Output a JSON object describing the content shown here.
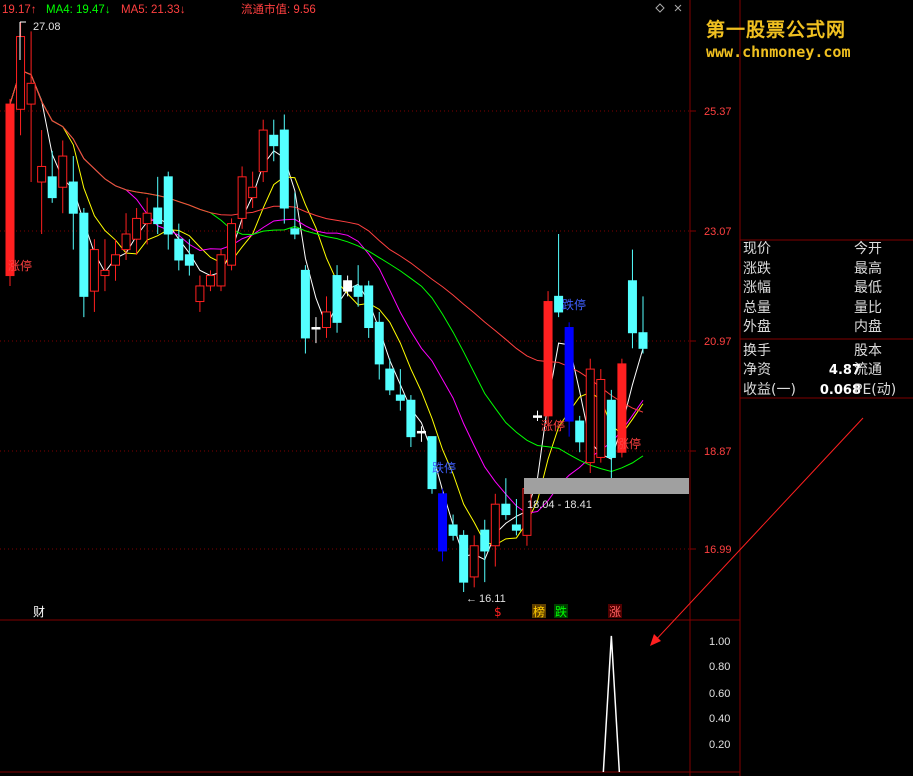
{
  "header": {
    "ma3": "19.17↑",
    "ma4": "MA4: 19.47↓",
    "ma5": "MA5: 21.33↓",
    "float_cap": "流通市值: 9.56"
  },
  "watermark": {
    "line1": "第一股票公式网",
    "line2": "www.chnmoney.com"
  },
  "quote_panel": {
    "rows": [
      {
        "left": "现价",
        "value": "",
        "right": "今开"
      },
      {
        "left": "涨跌",
        "value": "",
        "right": "最高"
      },
      {
        "left": "涨幅",
        "value": "",
        "right": "最低"
      },
      {
        "left": "总量",
        "value": "",
        "right": "量比"
      },
      {
        "left": "外盘",
        "value": "",
        "right": "内盘"
      },
      {
        "left": "换手",
        "value": "",
        "right": "股本"
      },
      {
        "left": "净资",
        "value": "4.87",
        "right": "流通"
      },
      {
        "left": "收益(一)",
        "value": "0.068",
        "right": "PE(动)"
      }
    ]
  },
  "colors": {
    "up": "#ff2020",
    "down": "#54ffff",
    "limit_down": "#0000ff",
    "grid": "#800000",
    "ma1": "#ffffff",
    "ma2": "#ffff00",
    "ma3": "#ff00ff",
    "ma4": "#00ff00",
    "ma5": "#ff4040"
  },
  "chart_data": [
    {
      "type": "candlestick",
      "y_ticks": [
        "25.37",
        "23.07",
        "20.97",
        "18.87",
        "16.99"
      ],
      "ylim": [
        14.5,
        29.0
      ],
      "grid": true,
      "price_high_label": "27.08",
      "price_low_label": "16.11",
      "range_box_label": "18.04 - 18.41",
      "range_box": [
        18.04,
        18.41
      ],
      "event_markers": [
        "财",
        "$",
        "榜",
        "跌",
        "涨"
      ],
      "annotations": [
        "涨停",
        "跌停",
        "涨停",
        "跌停",
        "涨停"
      ],
      "candles": [
        {
          "o": 22.2,
          "h": 25.6,
          "l": 22.0,
          "c": 25.5,
          "s": "limit_up"
        },
        {
          "o": 25.4,
          "h": 27.08,
          "l": 24.9,
          "c": 26.8,
          "s": "up"
        },
        {
          "o": 25.5,
          "h": 26.9,
          "l": 24.0,
          "c": 25.9,
          "s": "up"
        },
        {
          "o": 24.3,
          "h": 25.0,
          "l": 23.0,
          "c": 24.0,
          "s": "up"
        },
        {
          "o": 24.1,
          "h": 24.6,
          "l": 23.6,
          "c": 23.7,
          "s": "down"
        },
        {
          "o": 23.9,
          "h": 24.8,
          "l": 23.4,
          "c": 24.5,
          "s": "up"
        },
        {
          "o": 24.0,
          "h": 24.5,
          "l": 22.7,
          "c": 23.4,
          "s": "down"
        },
        {
          "o": 23.4,
          "h": 23.5,
          "l": 21.4,
          "c": 21.8,
          "s": "down"
        },
        {
          "o": 21.9,
          "h": 22.9,
          "l": 21.5,
          "c": 22.7,
          "s": "up"
        },
        {
          "o": 22.2,
          "h": 22.9,
          "l": 21.9,
          "c": 22.3,
          "s": "up"
        },
        {
          "o": 22.4,
          "h": 22.9,
          "l": 22.1,
          "c": 22.6,
          "s": "up"
        },
        {
          "o": 22.7,
          "h": 23.4,
          "l": 22.5,
          "c": 23.0,
          "s": "up"
        },
        {
          "o": 22.9,
          "h": 23.5,
          "l": 22.6,
          "c": 23.3,
          "s": "up"
        },
        {
          "o": 23.2,
          "h": 23.7,
          "l": 22.8,
          "c": 23.4,
          "s": "up"
        },
        {
          "o": 23.5,
          "h": 24.1,
          "l": 23.0,
          "c": 23.2,
          "s": "down"
        },
        {
          "o": 24.1,
          "h": 24.2,
          "l": 22.7,
          "c": 23.0,
          "s": "down"
        },
        {
          "o": 22.9,
          "h": 23.2,
          "l": 22.3,
          "c": 22.5,
          "s": "down"
        },
        {
          "o": 22.6,
          "h": 22.9,
          "l": 22.2,
          "c": 22.4,
          "s": "down"
        },
        {
          "o": 21.7,
          "h": 22.2,
          "l": 21.5,
          "c": 22.0,
          "s": "up"
        },
        {
          "o": 22.0,
          "h": 22.3,
          "l": 21.9,
          "c": 22.2,
          "s": "up"
        },
        {
          "o": 22.0,
          "h": 22.7,
          "l": 21.9,
          "c": 22.6,
          "s": "up"
        },
        {
          "o": 22.4,
          "h": 23.3,
          "l": 22.3,
          "c": 23.2,
          "s": "up"
        },
        {
          "o": 23.3,
          "h": 24.3,
          "l": 23.1,
          "c": 24.1,
          "s": "up"
        },
        {
          "o": 23.7,
          "h": 24.2,
          "l": 23.5,
          "c": 23.9,
          "s": "up"
        },
        {
          "o": 24.2,
          "h": 25.2,
          "l": 24.0,
          "c": 25.0,
          "s": "up"
        },
        {
          "o": 24.7,
          "h": 25.2,
          "l": 24.4,
          "c": 24.9,
          "s": "down"
        },
        {
          "o": 25.0,
          "h": 25.3,
          "l": 23.2,
          "c": 23.5,
          "s": "down"
        },
        {
          "o": 23.0,
          "h": 23.8,
          "l": 22.9,
          "c": 23.1,
          "s": "down"
        },
        {
          "o": 22.3,
          "h": 22.4,
          "l": 20.7,
          "c": 21.0,
          "s": "down"
        },
        {
          "o": 21.2,
          "h": 21.4,
          "l": 20.9,
          "c": 21.2,
          "s": "flat"
        },
        {
          "o": 21.2,
          "h": 21.8,
          "l": 21.0,
          "c": 21.5,
          "s": "up"
        },
        {
          "o": 21.3,
          "h": 22.4,
          "l": 21.1,
          "c": 22.2,
          "s": "down"
        },
        {
          "o": 21.9,
          "h": 22.2,
          "l": 21.8,
          "c": 22.1,
          "s": "flat"
        },
        {
          "o": 22.0,
          "h": 22.4,
          "l": 21.6,
          "c": 21.8,
          "s": "down"
        },
        {
          "o": 22.0,
          "h": 22.1,
          "l": 21.0,
          "c": 21.2,
          "s": "down"
        },
        {
          "o": 21.3,
          "h": 21.5,
          "l": 20.2,
          "c": 20.5,
          "s": "down"
        },
        {
          "o": 20.4,
          "h": 20.6,
          "l": 19.9,
          "c": 20.0,
          "s": "down"
        },
        {
          "o": 19.9,
          "h": 20.4,
          "l": 19.6,
          "c": 19.8,
          "s": "down"
        },
        {
          "o": 19.8,
          "h": 19.9,
          "l": 18.9,
          "c": 19.1,
          "s": "down"
        },
        {
          "o": 19.2,
          "h": 19.3,
          "l": 19.0,
          "c": 19.2,
          "s": "flat"
        },
        {
          "o": 19.1,
          "h": 19.1,
          "l": 18.0,
          "c": 18.1,
          "s": "down"
        },
        {
          "o": 18.0,
          "h": 18.1,
          "l": 16.7,
          "c": 16.9,
          "s": "limit_down"
        },
        {
          "o": 17.4,
          "h": 17.6,
          "l": 17.1,
          "c": 17.2,
          "s": "down"
        },
        {
          "o": 17.2,
          "h": 17.3,
          "l": 16.11,
          "c": 16.3,
          "s": "down"
        },
        {
          "o": 16.4,
          "h": 17.2,
          "l": 16.2,
          "c": 17.0,
          "s": "up"
        },
        {
          "o": 17.3,
          "h": 17.5,
          "l": 16.3,
          "c": 16.9,
          "s": "down"
        },
        {
          "o": 17.0,
          "h": 18.0,
          "l": 16.6,
          "c": 17.8,
          "s": "up"
        },
        {
          "o": 17.8,
          "h": 18.3,
          "l": 17.5,
          "c": 17.6,
          "s": "down"
        },
        {
          "o": 17.4,
          "h": 17.9,
          "l": 17.2,
          "c": 17.3,
          "s": "down"
        },
        {
          "o": 17.2,
          "h": 18.2,
          "l": 17.0,
          "c": 18.1,
          "s": "up"
        },
        {
          "o": 19.5,
          "h": 19.6,
          "l": 19.4,
          "c": 19.5,
          "s": "flat"
        },
        {
          "o": 19.5,
          "h": 21.9,
          "l": 19.3,
          "c": 21.7,
          "s": "limit_up"
        },
        {
          "o": 21.8,
          "h": 23.0,
          "l": 21.4,
          "c": 21.5,
          "s": "down"
        },
        {
          "o": 21.2,
          "h": 21.3,
          "l": 19.1,
          "c": 19.4,
          "s": "limit_down"
        },
        {
          "o": 19.4,
          "h": 19.5,
          "l": 18.8,
          "c": 19.0,
          "s": "down"
        },
        {
          "o": 20.4,
          "h": 20.6,
          "l": 18.4,
          "c": 18.6,
          "s": "up"
        },
        {
          "o": 20.2,
          "h": 20.4,
          "l": 18.6,
          "c": 18.7,
          "s": "up"
        },
        {
          "o": 19.8,
          "h": 20.0,
          "l": 18.3,
          "c": 18.7,
          "s": "down"
        },
        {
          "o": 18.8,
          "h": 20.6,
          "l": 18.7,
          "c": 20.5,
          "s": "limit_up"
        },
        {
          "o": 22.1,
          "h": 22.7,
          "l": 20.8,
          "c": 21.1,
          "s": "down"
        },
        {
          "o": 21.1,
          "h": 21.8,
          "l": 20.7,
          "c": 20.8,
          "s": "down"
        }
      ]
    },
    {
      "type": "line",
      "y_ticks": [
        "1.00",
        "0.80",
        "0.60",
        "0.40",
        "0.20"
      ],
      "ylim": [
        0,
        1.08
      ],
      "spike_value": 1.0,
      "spike_index": 57
    }
  ]
}
